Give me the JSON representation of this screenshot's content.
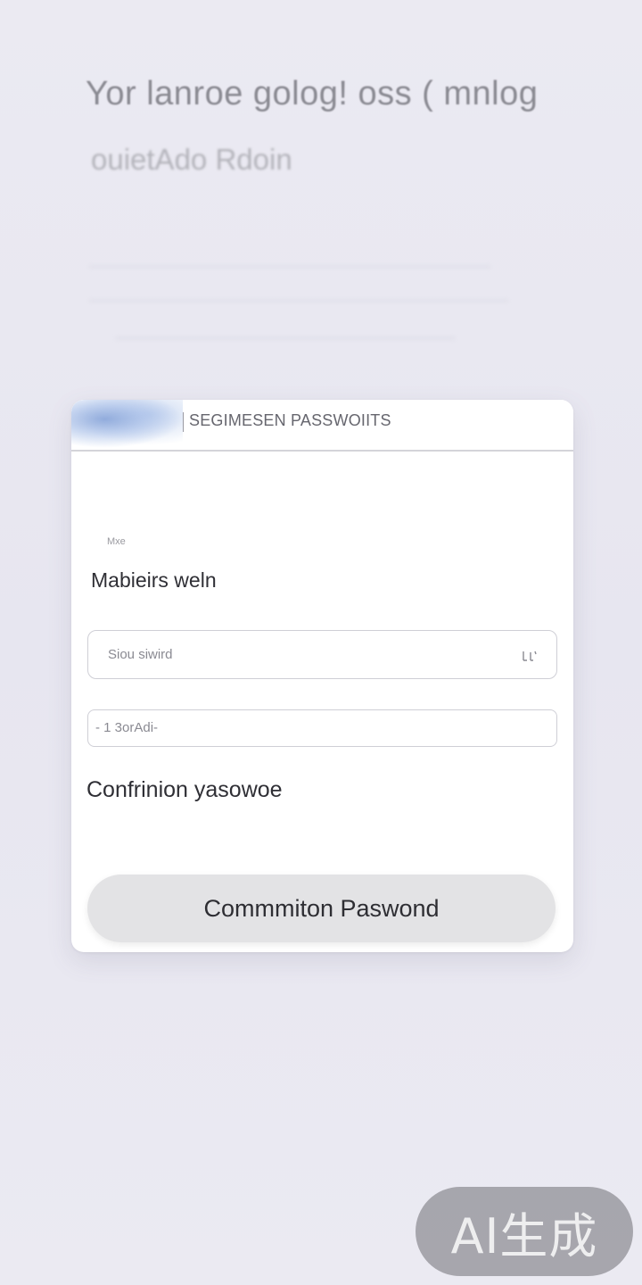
{
  "background": {
    "headline": "Yor lanroe golog! oss ( mnlog",
    "subtext": "ouietAdo Rdoin"
  },
  "card": {
    "title": "SEGIMESEN PASSWOIITS",
    "caption": "Mxe",
    "section_label": "Mabieirs weln",
    "password_field": {
      "placeholder": "Siou siwird",
      "icon": "eye-icon"
    },
    "second_field": {
      "value": "- 1 3orAdi-"
    },
    "confirm_label": "Confrinion yasowoe",
    "submit_label": "Commmiton Paswond"
  },
  "watermark": "AI生成"
}
